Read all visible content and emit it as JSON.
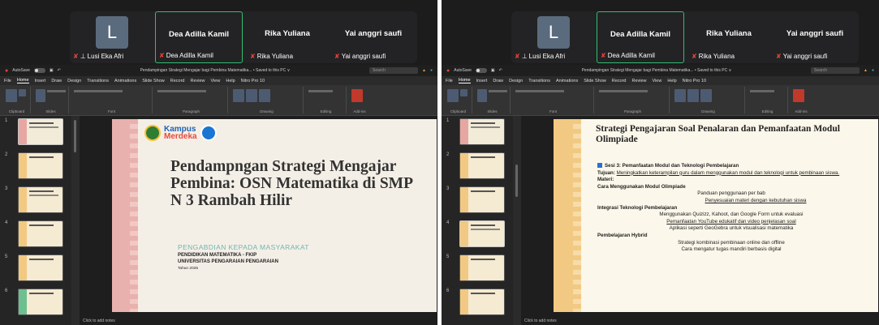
{
  "left": {
    "participants": [
      {
        "initial": "L",
        "label": "Lusi Eka Afri",
        "pinned": true
      },
      {
        "name": "Dea Adilla Kamil",
        "label": "Dea Adilla Kamil",
        "active": true
      },
      {
        "name": "Rika Yuliana",
        "label": "Rika Yuliana"
      },
      {
        "name": "Yai anggri saufi",
        "label": "Yai anggri saufi"
      }
    ],
    "ppt": {
      "autosave": "AutoSave",
      "doc_title": "Pendampingan Strategi Mengajar bagi Pembina Matematika... • Saved to this PC ∨",
      "search": "Search",
      "menu": [
        "File",
        "Home",
        "Insert",
        "Draw",
        "Design",
        "Transitions",
        "Animations",
        "Slide Show",
        "Record",
        "Review",
        "View",
        "Help",
        "Nitro Pro 10"
      ],
      "ribbon_groups": [
        "Clipboard",
        "Slides",
        "Font",
        "Paragraph",
        "Drawing",
        "Editing",
        "Add-ins"
      ],
      "slide_numbers": [
        "1",
        "2",
        "3",
        "4",
        "5",
        "6"
      ],
      "notes": "Click to add notes"
    },
    "slide": {
      "logo_line1": "Kampus",
      "logo_line2": "Merdeka",
      "title": "Pendampngan Strategi Mengajar Pembina: OSN Matematika di SMP N 3 Rambah Hilir",
      "subtitle": "PENGABDIAN KEPADA MASYARAKAT",
      "dept": "PENDIDIKAN MATEMATIKA - FKIP",
      "univ": "UNIVERSITAS PENGARAIAN PENGARAIAN",
      "year": "Tahun 2025"
    }
  },
  "right": {
    "participants": [
      {
        "initial": "L",
        "label": "Lusi Eka Afri",
        "pinned": true
      },
      {
        "name": "Dea Adilla Kamil",
        "label": "Dea Adilla Kamil",
        "active": true
      },
      {
        "name": "Rika Yuliana",
        "label": "Rika Yuliana"
      },
      {
        "name": "Yai anggri saufi",
        "label": "Yai anggri saufi"
      }
    ],
    "ppt": {
      "autosave": "AutoSave",
      "doc_title": "Pendampingan Strategi Mengajar bagi Pembina Matematika... • Saved to this PC ∨",
      "search": "Search",
      "menu": [
        "File",
        "Home",
        "Insert",
        "Draw",
        "Design",
        "Transitions",
        "Animations",
        "Slide Show",
        "Record",
        "Review",
        "View",
        "Help",
        "Nitro Pro 10"
      ],
      "ribbon_groups": [
        "Clipboard",
        "Slides",
        "Font",
        "Paragraph",
        "Drawing",
        "Editing",
        "Add-ins"
      ],
      "slide_numbers": [
        "1",
        "2",
        "3",
        "4",
        "5",
        "6"
      ],
      "notes": "Click to add notes"
    },
    "slide": {
      "title": "Strategi Pengajaran Soal Penalaran dan Pemanfaatan Modul Olimpiade",
      "session": "Sesi 3: Pemanfaatan Modul dan Teknologi Pembelajaran",
      "goal_label": "Tujuan:",
      "goal_text": "Meningkatkan keterampilan guru dalam menggunakan modul dan teknologi untuk pembinaan siswa.",
      "materi": "Materi:",
      "h_modul": "Cara Menggunakan Modul Olimpiade",
      "modul_1": "Panduan penggunaan per bab",
      "modul_2": "Penyesuaian materi dengan kebutuhan siswa",
      "h_integrasi": "Integrasi Teknologi Pembelajaran",
      "integrasi_1": "Menggunakan Quizizz, Kahoot, dan Google Form untuk evaluasi",
      "integrasi_2": "Pemanfaatan YouTube edukatif dan video penjelasan soal",
      "integrasi_3": "Aplikasi seperti GeoGebra untuk visualisasi matematika",
      "h_hybrid": "Pembelajaran Hybrid",
      "hybrid_1": "Strategi kombinasi pembinaan online dan offline",
      "hybrid_2": "Cara mengatur tugas mandiri berbasis digital"
    }
  }
}
